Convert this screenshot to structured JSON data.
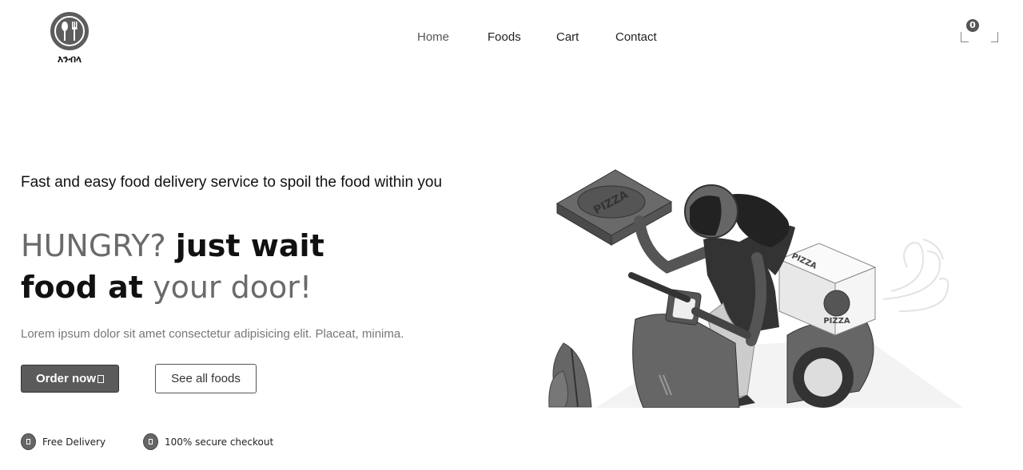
{
  "brand": {
    "name": "እንብላ"
  },
  "nav": {
    "items": [
      {
        "label": "Home",
        "active": true
      },
      {
        "label": "Foods",
        "active": false
      },
      {
        "label": "Cart",
        "active": false
      },
      {
        "label": "Contact",
        "active": false
      }
    ]
  },
  "header": {
    "cart_count": "0",
    "cart_icon": "cart-icon",
    "menu_icon": "user-icon"
  },
  "hero": {
    "subtitle": "Fast and easy food delivery service to spoil the food within you",
    "headline": {
      "part1_accent": "HUNGRY?",
      "part1_rest": "just wait",
      "part2_strong": "food at",
      "part2_accent": "your door!"
    },
    "description": "Lorem ipsum dolor sit amet consectetur adipisicing elit. Placeat, minima.",
    "order_button": "Order now",
    "all_foods_button": "See all foods"
  },
  "features": [
    {
      "label": "Free Delivery",
      "icon": "car-icon"
    },
    {
      "label": "100% secure checkout",
      "icon": "shield-icon"
    }
  ],
  "colors": {
    "accent": "#5b5b5b",
    "text": "#111111",
    "muted": "#777777"
  }
}
